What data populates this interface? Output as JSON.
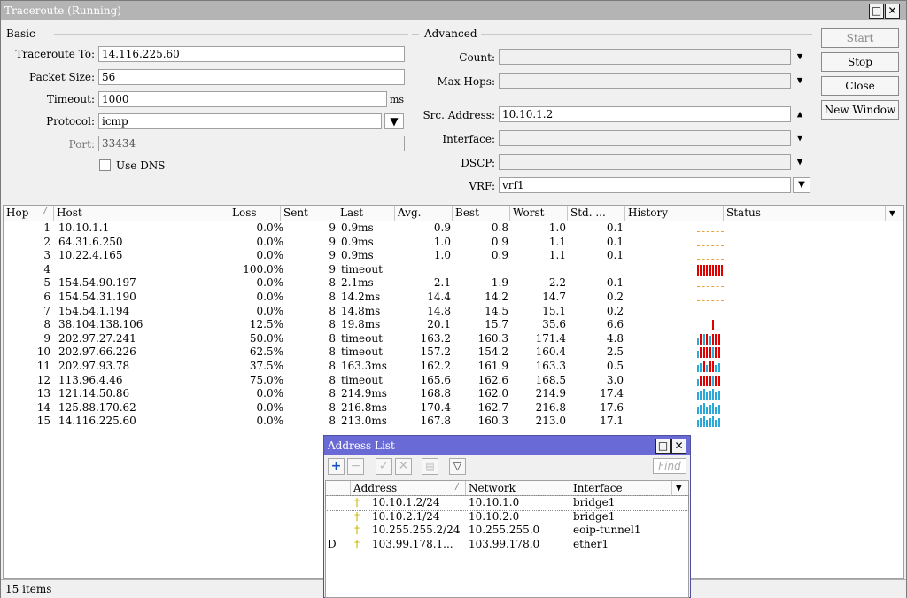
{
  "window": {
    "title": "Traceroute (Running)"
  },
  "basic": {
    "group_label": "Basic",
    "traceroute_to_label": "Traceroute To:",
    "traceroute_to": "14.116.225.60",
    "packet_size_label": "Packet Size:",
    "packet_size": "56",
    "timeout_label": "Timeout:",
    "timeout": "1000",
    "timeout_unit": "ms",
    "protocol_label": "Protocol:",
    "protocol": "icmp",
    "port_label": "Port:",
    "port": "33434",
    "use_dns_label": "Use DNS"
  },
  "advanced": {
    "group_label": "Advanced",
    "count_label": "Count:",
    "count": "",
    "max_hops_label": "Max Hops:",
    "max_hops": "",
    "src_address_label": "Src. Address:",
    "src_address": "10.10.1.2",
    "interface_label": "Interface:",
    "interface": "",
    "dscp_label": "DSCP:",
    "dscp": "",
    "vrf_label": "VRF:",
    "vrf": "vrf1"
  },
  "actions": {
    "start": "Start",
    "stop": "Stop",
    "close": "Close",
    "new_window": "New Window"
  },
  "table": {
    "columns": [
      "Hop",
      "Host",
      "Loss",
      "Sent",
      "Last",
      "Avg.",
      "Best",
      "Worst",
      "Std. ...",
      "History",
      "Status"
    ],
    "rows": [
      {
        "hop": "1",
        "host": "10.10.1.1",
        "loss": "0.0%",
        "sent": "9",
        "last": "0.9ms",
        "avg": "0.9",
        "best": "0.8",
        "worst": "1.0",
        "std": "0.1",
        "hist": "flat"
      },
      {
        "hop": "2",
        "host": "64.31.6.250",
        "loss": "0.0%",
        "sent": "9",
        "last": "0.9ms",
        "avg": "1.0",
        "best": "0.9",
        "worst": "1.1",
        "std": "0.1",
        "hist": "flat"
      },
      {
        "hop": "3",
        "host": "10.22.4.165",
        "loss": "0.0%",
        "sent": "9",
        "last": "0.9ms",
        "avg": "1.0",
        "best": "0.9",
        "worst": "1.1",
        "std": "0.1",
        "hist": "flat"
      },
      {
        "hop": "4",
        "host": "",
        "loss": "100.0%",
        "sent": "9",
        "last": "timeout",
        "avg": "",
        "best": "",
        "worst": "",
        "std": "",
        "hist": "red"
      },
      {
        "hop": "5",
        "host": "154.54.90.197",
        "loss": "0.0%",
        "sent": "8",
        "last": "2.1ms",
        "avg": "2.1",
        "best": "1.9",
        "worst": "2.2",
        "std": "0.1",
        "hist": "flat"
      },
      {
        "hop": "6",
        "host": "154.54.31.190",
        "loss": "0.0%",
        "sent": "8",
        "last": "14.2ms",
        "avg": "14.4",
        "best": "14.2",
        "worst": "14.7",
        "std": "0.2",
        "hist": "flat"
      },
      {
        "hop": "7",
        "host": "154.54.1.194",
        "loss": "0.0%",
        "sent": "8",
        "last": "14.8ms",
        "avg": "14.8",
        "best": "14.5",
        "worst": "15.1",
        "std": "0.2",
        "hist": "flat"
      },
      {
        "hop": "8",
        "host": "38.104.138.106",
        "loss": "12.5%",
        "sent": "8",
        "last": "19.8ms",
        "avg": "20.1",
        "best": "15.7",
        "worst": "35.6",
        "std": "6.6",
        "hist": "spike"
      },
      {
        "hop": "9",
        "host": "202.97.27.241",
        "loss": "50.0%",
        "sent": "8",
        "last": "timeout",
        "avg": "163.2",
        "best": "160.3",
        "worst": "171.4",
        "std": "4.8",
        "hist": "mixA"
      },
      {
        "hop": "10",
        "host": "202.97.66.226",
        "loss": "62.5%",
        "sent": "8",
        "last": "timeout",
        "avg": "157.2",
        "best": "154.2",
        "worst": "160.4",
        "std": "2.5",
        "hist": "mixB"
      },
      {
        "hop": "11",
        "host": "202.97.93.78",
        "loss": "37.5%",
        "sent": "8",
        "last": "163.3ms",
        "avg": "162.2",
        "best": "161.9",
        "worst": "163.3",
        "std": "0.5",
        "hist": "mixC"
      },
      {
        "hop": "12",
        "host": "113.96.4.46",
        "loss": "75.0%",
        "sent": "8",
        "last": "timeout",
        "avg": "165.6",
        "best": "162.6",
        "worst": "168.5",
        "std": "3.0",
        "hist": "mixD"
      },
      {
        "hop": "13",
        "host": "121.14.50.86",
        "loss": "0.0%",
        "sent": "8",
        "last": "214.9ms",
        "avg": "168.8",
        "best": "162.0",
        "worst": "214.9",
        "std": "17.4",
        "hist": "blue"
      },
      {
        "hop": "14",
        "host": "125.88.170.62",
        "loss": "0.0%",
        "sent": "8",
        "last": "216.8ms",
        "avg": "170.4",
        "best": "162.7",
        "worst": "216.8",
        "std": "17.6",
        "hist": "blue"
      },
      {
        "hop": "15",
        "host": "14.116.225.60",
        "loss": "0.0%",
        "sent": "8",
        "last": "213.0ms",
        "avg": "167.8",
        "best": "160.3",
        "worst": "213.0",
        "std": "17.1",
        "hist": "blue"
      }
    ]
  },
  "status_bar": {
    "items_count": "15 items"
  },
  "colors": {
    "timeout_red": "#e00000",
    "ok_blue": "#2aa8d8",
    "flat_orange": "#f0a030",
    "popup_title": "#6a6ad6"
  },
  "address_list": {
    "title": "Address List",
    "find_placeholder": "Find",
    "columns": [
      "Address",
      "Network",
      "Interface"
    ],
    "rows": [
      {
        "flag": "",
        "address": "10.10.1.2/24",
        "network": "10.10.1.0",
        "interface": "bridge1"
      },
      {
        "flag": "",
        "address": "10.10.2.1/24",
        "network": "10.10.2.0",
        "interface": "bridge1"
      },
      {
        "flag": "",
        "address": "10.255.255.2/24",
        "network": "10.255.255.0",
        "interface": "eoip-tunnel1"
      },
      {
        "flag": "D",
        "address": "103.99.178.1...",
        "network": "103.99.178.0",
        "interface": "ether1"
      }
    ]
  }
}
